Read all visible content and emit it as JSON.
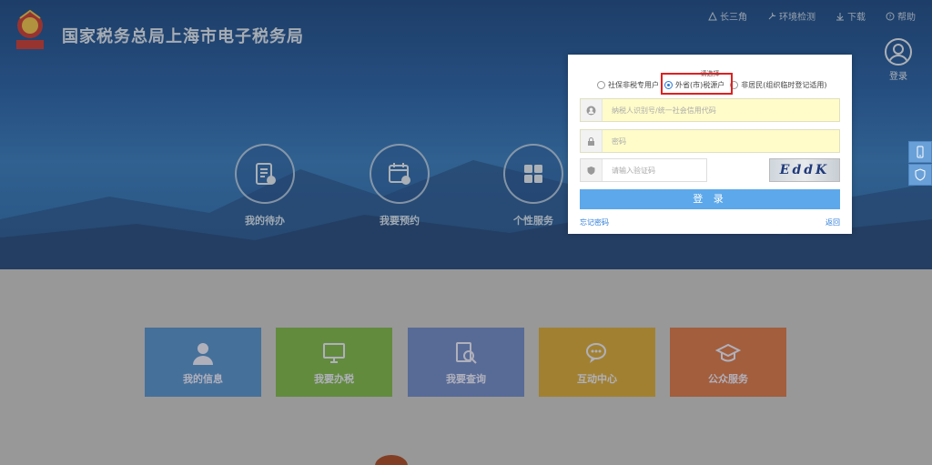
{
  "header": {
    "site_title": "国家税务总局上海市电子税务局",
    "nav": [
      "长三角",
      "环境检测",
      "下载",
      "帮助"
    ],
    "login_label": "登录"
  },
  "services": [
    {
      "label": "我的待办",
      "icon": "todo-doc-icon"
    },
    {
      "label": "我要预约",
      "icon": "calendar-icon"
    },
    {
      "label": "个性服务",
      "icon": "grid-icon"
    }
  ],
  "tiles": [
    {
      "label": "我的信息",
      "icon": "user-icon",
      "color": "#4b8ccd"
    },
    {
      "label": "我要办税",
      "icon": "monitor-icon",
      "color": "#77b53f"
    },
    {
      "label": "我要查询",
      "icon": "search-doc-icon",
      "color": "#6785c8"
    },
    {
      "label": "互动中心",
      "icon": "chat-icon",
      "color": "#d8a72c"
    },
    {
      "label": "公众服务",
      "icon": "graduation-icon",
      "color": "#d9703e"
    }
  ],
  "dialog": {
    "hint": "请选择",
    "radios": [
      {
        "label": "社保非税专用户",
        "selected": false
      },
      {
        "label": "外省(市)税源户",
        "selected": true
      },
      {
        "label": "非居民(组织临时登记适用)",
        "selected": false
      }
    ],
    "taxpayer_placeholder": "纳税人识别号/统一社会信用代码",
    "password_placeholder": "密码",
    "captcha_placeholder": "请输入验证码",
    "captcha_text": "EddK",
    "login_button": "登 录",
    "forgot_link": "忘记密码",
    "back_link": "返回"
  },
  "colors": {
    "accent": "#5da8ea",
    "highlight": "#e02020"
  }
}
